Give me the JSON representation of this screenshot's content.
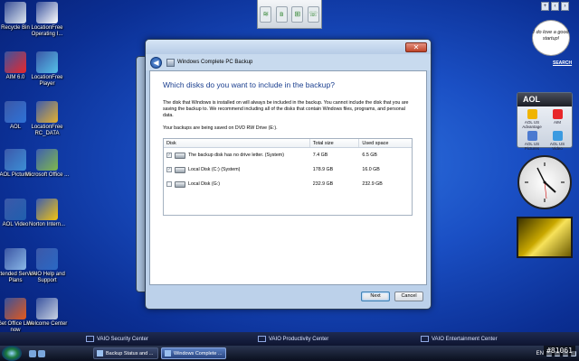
{
  "desktop_icons": [
    {
      "label": "Recycle Bin",
      "color": "#dfe7ef"
    },
    {
      "label": "LocationFree Operating I...",
      "color": "#ffffff"
    },
    {
      "label": "AIM 6.0",
      "color": "#e8262a"
    },
    {
      "label": "LocationFree Player",
      "color": "#54c0e8"
    },
    {
      "label": "AOL",
      "color": "#2e72d6"
    },
    {
      "label": "LocationFree RC_DATA",
      "color": "#e3b02f"
    },
    {
      "label": "AOL Pictures",
      "color": "#3c8dd4"
    },
    {
      "label": "Microsoft Office ...",
      "color": "#7fb94a"
    },
    {
      "label": "AOL Video",
      "color": "#1f5fae"
    },
    {
      "label": "Norton Intern...",
      "color": "#f2c40f"
    },
    {
      "label": "Extended Service Plans",
      "color": "#8ab8e8"
    },
    {
      "label": "VAIO Help and Support",
      "color": "#2a68c4"
    },
    {
      "label": "Get Office Live now",
      "color": "#e3591c"
    },
    {
      "label": "Welcome Center",
      "color": "#c9d3e3"
    }
  ],
  "window": {
    "title": "Windows Complete PC Backup",
    "close_glyph": "✕",
    "heading": "Which disks do you want to include in the backup?",
    "description": "The disk that Windows is installed on will always be included in the backup. You cannot include the disk that you are saving the backup to. We recommend including all of the disks that contain Windows files, programs, and personal data.",
    "saved_on": "Your backups are being saved on DVD RW Drive (E:).",
    "columns": [
      "Disk",
      "Total size",
      "Used space"
    ],
    "rows": [
      {
        "disk": "The backup disk has no drive letter. (System)",
        "total": "7.4 GB",
        "used": "6.5 GB",
        "checked": true
      },
      {
        "disk": "Local Disk (C:) (System)",
        "total": "178.9 GB",
        "used": "16.0 GB",
        "checked": true
      },
      {
        "disk": "Local Disk (G:)",
        "total": "232.9 GB",
        "used": "232.9 GB",
        "checked": false
      }
    ],
    "next_label": "Next",
    "cancel_label": "Cancel"
  },
  "sidebar": {
    "search_label": "SEARCH",
    "note_text": "I do love a good startup!",
    "aol_title": "AOL",
    "aol_items": [
      "AOL US Advantage",
      "AIM",
      "AOL US Pictures",
      "AOL US Video"
    ]
  },
  "taskbar": {
    "vaio_items": [
      "VAIO Security Center",
      "VAIO Productivity Center",
      "VAIO Entertainment Center"
    ],
    "tasks": [
      {
        "label": "Backup Status and ...",
        "active": false
      },
      {
        "label": "Windows Complete ...",
        "active": true
      }
    ],
    "language": "EN",
    "watermark": "#81061"
  }
}
